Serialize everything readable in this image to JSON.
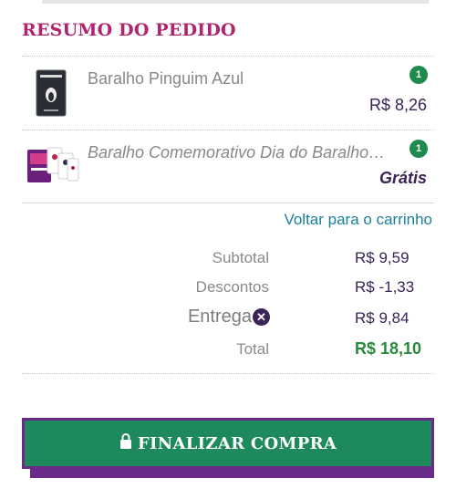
{
  "summary": {
    "title": "RESUMO DO PEDIDO",
    "items": [
      {
        "name": "Baralho Pinguim Azul",
        "quantity": "1",
        "price": "R$ 8,26",
        "thumb_icon": "deck-of-cards-image"
      },
      {
        "name": "Baralho Comemorativo Dia do Baralho…",
        "quantity": "1",
        "price": "Grátis",
        "thumb_icon": "commemorative-deck-image"
      }
    ],
    "back_link": "Voltar para o carrinho",
    "subtotal_label": "Subtotal",
    "subtotal_value": "R$ 9,59",
    "discount_label": "Descontos",
    "discount_value": "R$ -1,33",
    "shipping_label": "Entrega",
    "shipping_value": "R$ 9,84",
    "total_label": "Total",
    "total_value": "R$ 18,10"
  },
  "checkout": {
    "button_label": "FINALIZAR COMPRA",
    "icon": "lock-icon"
  },
  "colors": {
    "accent": "#b0236f",
    "button": "#1e8a5c",
    "button_border": "#6a2a8a",
    "badge": "#1e8a4e",
    "price": "#3a2356",
    "link": "#1a7f9a",
    "total": "#2a8a3c"
  }
}
